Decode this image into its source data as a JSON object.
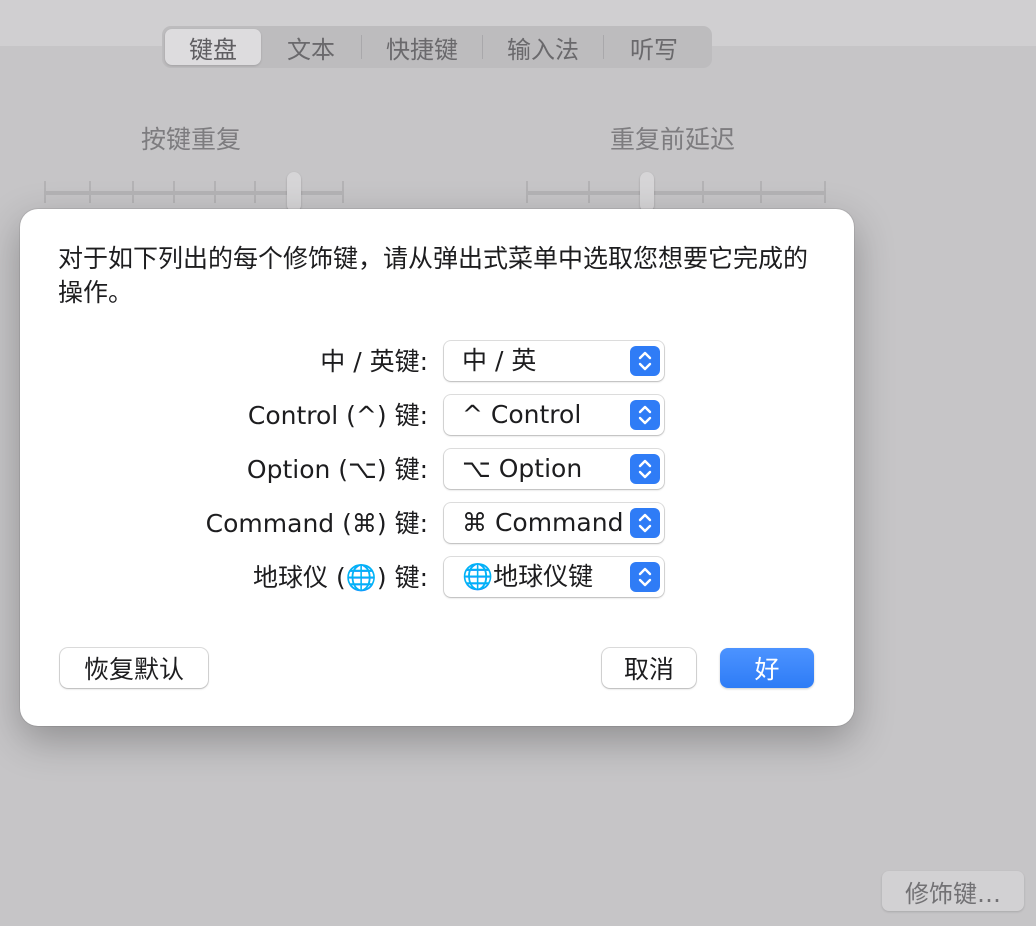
{
  "tabs": [
    {
      "label": "键盘",
      "active": true
    },
    {
      "label": "文本",
      "active": false
    },
    {
      "label": "快捷键",
      "active": false
    },
    {
      "label": "输入法",
      "active": false
    },
    {
      "label": "听写",
      "active": false
    }
  ],
  "background": {
    "key_repeat_label": "按键重复",
    "repeat_delay_label": "重复前延迟",
    "modifier_keys_button": "修饰键…"
  },
  "dialog": {
    "message": "对于如下列出的每个修饰键，请从弹出式菜单中选取您想要它完成的操作。",
    "rows": [
      {
        "label": "中 / 英键:",
        "value": "中 / 英"
      },
      {
        "label": "Control (^) 键:",
        "value": "^ Control"
      },
      {
        "label": "Option (⌥) 键:",
        "value": "⌥ Option"
      },
      {
        "label": "Command (⌘) 键:",
        "value": "⌘ Command"
      },
      {
        "label": "地球仪 (🌐) 键:",
        "value": "🌐地球仪键"
      }
    ],
    "restore_defaults": "恢复默认",
    "cancel": "取消",
    "ok": "好"
  },
  "colors": {
    "accent": "#2f7cf6",
    "dim_background": "#c6c5c7"
  },
  "icons": {
    "popup_stepper": "up-down-chevron-icon",
    "globe": "globe-icon"
  }
}
